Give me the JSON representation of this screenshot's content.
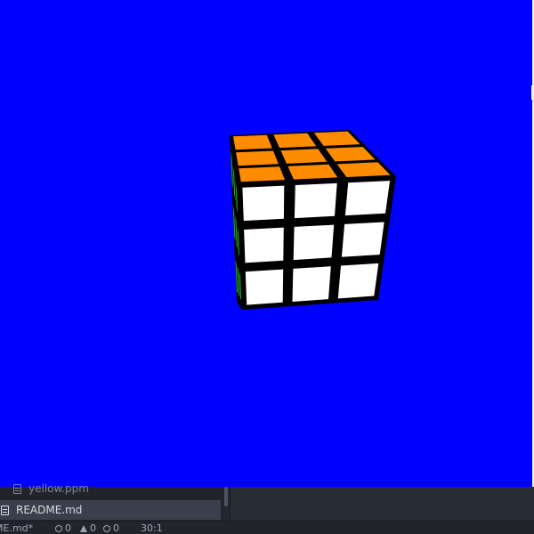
{
  "scene": {
    "background_color": "#0000ff",
    "cube": {
      "name": "rubiks-cube",
      "top_color": "#ff8c00",
      "front_color": "#ffffff",
      "side_color": "#22aa22",
      "sticker_border_color": "#000000",
      "top_stickers": [
        "orange",
        "orange",
        "orange",
        "orange",
        "orange",
        "orange",
        "orange",
        "orange",
        "orange"
      ],
      "front_stickers": [
        "white",
        "white",
        "white",
        "white",
        "white",
        "white",
        "white",
        "white",
        "white"
      ]
    }
  },
  "file_list": {
    "items": [
      {
        "label": "yellow.ppm",
        "icon": "file-text-icon"
      },
      {
        "label": "README.md",
        "icon": "file-text-icon",
        "active": true
      }
    ]
  },
  "status_bar": {
    "file": "ME.md*",
    "errors": "0",
    "warnings": "0",
    "info": "0",
    "cursor": "30:1"
  }
}
